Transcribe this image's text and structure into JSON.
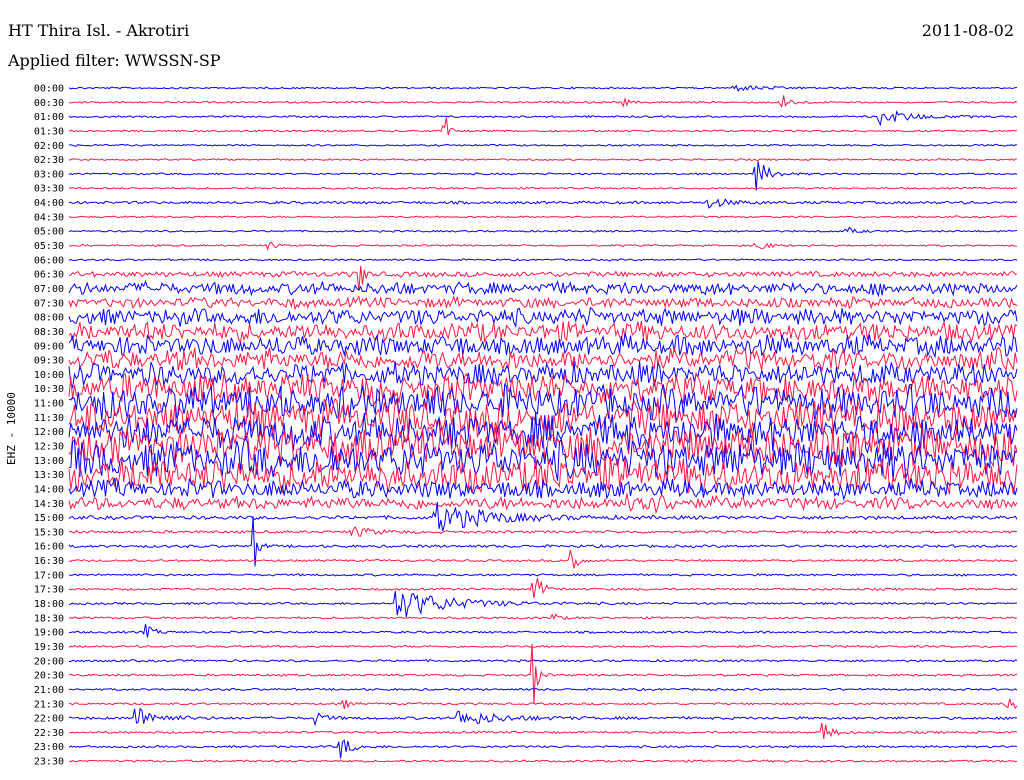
{
  "header": {
    "station": "HT Thira Isl. - Akrotiri",
    "filter": "Applied filter: WWSSN-SP",
    "date": "2011-08-02"
  },
  "chart_data": {
    "type": "line",
    "title": "HT Thira Isl. - Akrotiri",
    "subtitle": "Applied filter: WWSSN-SP",
    "date": "2011-08-02",
    "ylabel": "EHZ - 10000",
    "colors": [
      "#0000ff",
      "#ff1744"
    ],
    "row_labels": [
      "00:00",
      "00:30",
      "01:00",
      "01:30",
      "02:00",
      "02:30",
      "03:00",
      "03:30",
      "04:00",
      "04:30",
      "05:00",
      "05:30",
      "06:00",
      "06:30",
      "07:00",
      "07:30",
      "08:00",
      "08:30",
      "09:00",
      "09:30",
      "10:00",
      "10:30",
      "11:00",
      "11:30",
      "12:00",
      "12:30",
      "13:00",
      "13:30",
      "14:00",
      "14:30",
      "15:00",
      "15:30",
      "16:00",
      "16:30",
      "17:00",
      "17:30",
      "18:00",
      "18:30",
      "19:00",
      "19:30",
      "20:00",
      "20:30",
      "21:00",
      "21:30",
      "22:00",
      "22:30",
      "23:00",
      "23:30"
    ],
    "noise_level": [
      1,
      1,
      1,
      1,
      1,
      1,
      1,
      1,
      1.5,
      1,
      1,
      1,
      1,
      3,
      6,
      5,
      8,
      9,
      10,
      10,
      11,
      14,
      16,
      17,
      17,
      18,
      18,
      17,
      9,
      6,
      2,
      1.5,
      1.5,
      1.2,
      1.2,
      1.2,
      1.2,
      1.2,
      1.2,
      1.2,
      1.2,
      1.2,
      1.2,
      1.2,
      1.5,
      1.2,
      1.2,
      1.2
    ],
    "events": [
      {
        "row": 0,
        "t": 0.7,
        "amp": 3,
        "dur": 0.03
      },
      {
        "row": 1,
        "t": 0.585,
        "amp": 5,
        "dur": 0.005
      },
      {
        "row": 1,
        "t": 0.75,
        "amp": 10,
        "dur": 0.01
      },
      {
        "row": 2,
        "t": 0.855,
        "amp": 8,
        "dur": 0.03
      },
      {
        "row": 3,
        "t": 0.395,
        "amp": 40,
        "dur": 0.003
      },
      {
        "row": 6,
        "t": 0.725,
        "amp": 16,
        "dur": 0.012
      },
      {
        "row": 8,
        "t": 0.675,
        "amp": 5,
        "dur": 0.02
      },
      {
        "row": 10,
        "t": 0.82,
        "amp": 4,
        "dur": 0.01
      },
      {
        "row": 11,
        "t": 0.21,
        "amp": 6,
        "dur": 0.005
      },
      {
        "row": 11,
        "t": 0.725,
        "amp": 8,
        "dur": 0.008
      },
      {
        "row": 13,
        "t": 0.305,
        "amp": 45,
        "dur": 0.003
      },
      {
        "row": 29,
        "t": 0.59,
        "amp": 12,
        "dur": 0.03
      },
      {
        "row": 30,
        "t": 0.385,
        "amp": 16,
        "dur": 0.05
      },
      {
        "row": 31,
        "t": 0.3,
        "amp": 5,
        "dur": 0.02
      },
      {
        "row": 32,
        "t": 0.195,
        "amp": 30,
        "dur": 0.004
      },
      {
        "row": 33,
        "t": 0.53,
        "amp": 35,
        "dur": 0.004
      },
      {
        "row": 35,
        "t": 0.49,
        "amp": 18,
        "dur": 0.008
      },
      {
        "row": 36,
        "t": 0.345,
        "amp": 16,
        "dur": 0.05
      },
      {
        "row": 37,
        "t": 0.51,
        "amp": 6,
        "dur": 0.005
      },
      {
        "row": 38,
        "t": 0.08,
        "amp": 8,
        "dur": 0.008
      },
      {
        "row": 41,
        "t": 0.49,
        "amp": 35,
        "dur": 0.004
      },
      {
        "row": 43,
        "t": 0.29,
        "amp": 5,
        "dur": 0.005
      },
      {
        "row": 43,
        "t": 0.99,
        "amp": 10,
        "dur": 0.01
      },
      {
        "row": 44,
        "t": 0.07,
        "amp": 12,
        "dur": 0.02
      },
      {
        "row": 44,
        "t": 0.26,
        "amp": 6,
        "dur": 0.01
      },
      {
        "row": 44,
        "t": 0.41,
        "amp": 8,
        "dur": 0.04
      },
      {
        "row": 45,
        "t": 0.795,
        "amp": 12,
        "dur": 0.008
      },
      {
        "row": 46,
        "t": 0.285,
        "amp": 14,
        "dur": 0.01
      }
    ]
  }
}
